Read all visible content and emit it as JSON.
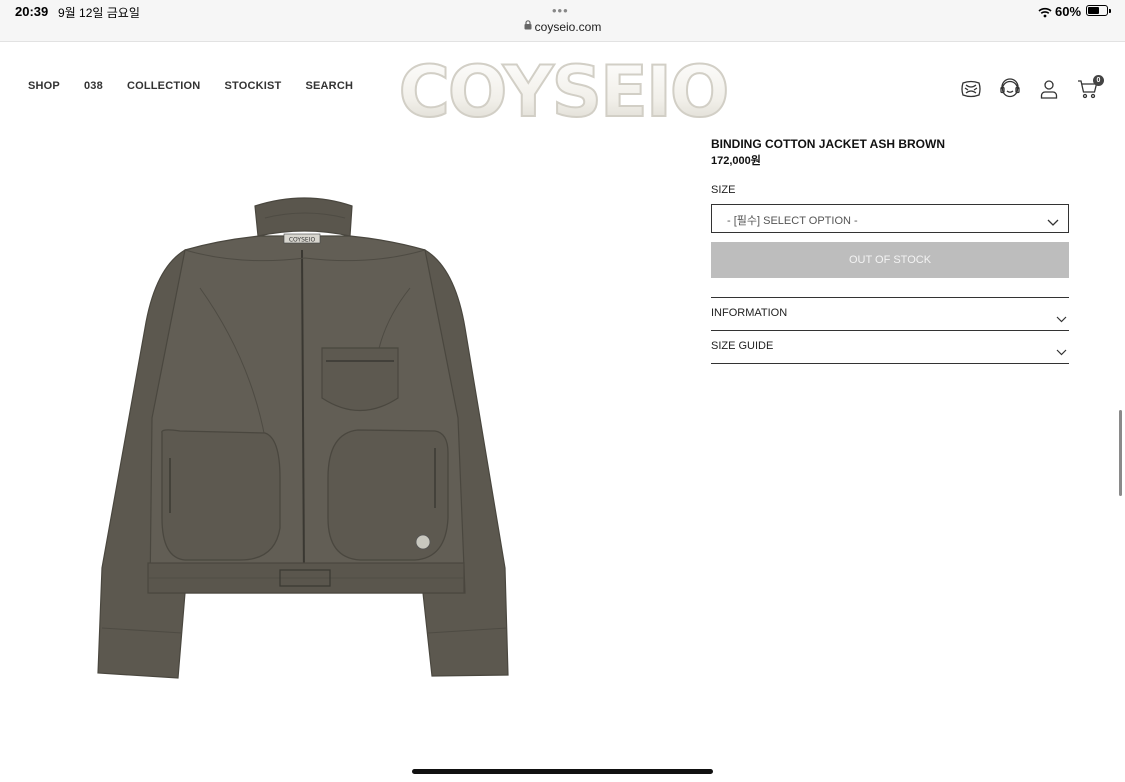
{
  "status_bar": {
    "time": "20:39",
    "date": "9월 12일 금요일",
    "dots": "•••",
    "url": "coyseio.com",
    "battery_percent": "60%",
    "battery_level": 0.6
  },
  "header": {
    "nav": [
      {
        "label": "SHOP"
      },
      {
        "label": "038"
      },
      {
        "label": "COLLECTION"
      },
      {
        "label": "STOCKIST"
      },
      {
        "label": "SEARCH"
      }
    ],
    "logo_text": "COYSEIO",
    "icons": [
      "globe-icon",
      "support-icon",
      "account-icon",
      "cart-icon"
    ],
    "cart_count": "0"
  },
  "product": {
    "name": "BINDING COTTON JACKET ASH BROWN",
    "price": "172,000원",
    "label_tag": "COYSEIO",
    "size_label": "SIZE",
    "select_placeholder": "- [필수] SELECT OPTION -",
    "button_label": "OUT OF STOCK",
    "accordion": [
      {
        "label": "INFORMATION"
      },
      {
        "label": "SIZE GUIDE"
      }
    ]
  },
  "colors": {
    "jacket": "#5f5b52",
    "button_disabled": "#bdbdbd",
    "text": "#111111"
  }
}
